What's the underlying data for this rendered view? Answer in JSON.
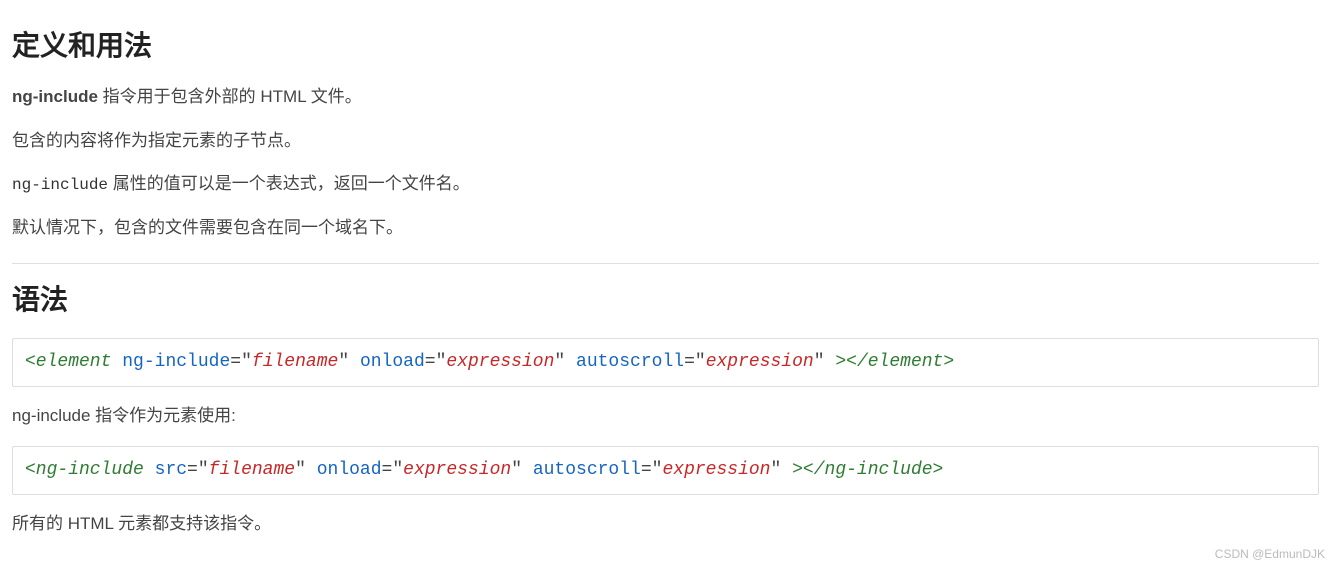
{
  "section_definition": {
    "heading": "定义和用法",
    "p1_prefix_bold": "ng-include",
    "p1_rest": " 指令用于包含外部的 HTML 文件。",
    "p2": "包含的内容将作为指定元素的子节点。",
    "p3_code": "ng-include",
    "p3_rest": " 属性的值可以是一个表达式，返回一个文件名。",
    "p4": "默认情况下，包含的文件需要包含在同一个域名下。"
  },
  "section_syntax": {
    "heading": "语法",
    "code1": {
      "open_tag_element": "<element",
      "attr1": "ng-include",
      "val1": "filename",
      "attr2": "onload",
      "val2": "expression",
      "attr3": "autoscroll",
      "val3": "expression",
      "close_open": " >",
      "close_tag": "</element>"
    },
    "p_mid": "ng-include 指令作为元素使用:",
    "code2": {
      "open_tag_element": "<ng-include",
      "attr1": "src",
      "val1": "filename",
      "attr2": "onload",
      "val2": "expression",
      "attr3": "autoscroll",
      "val3": "expression",
      "close_open": " >",
      "close_tag": "</ng-include>"
    },
    "p_end": "所有的 HTML 元素都支持该指令。"
  },
  "watermark": "CSDN @EdmunDJK"
}
